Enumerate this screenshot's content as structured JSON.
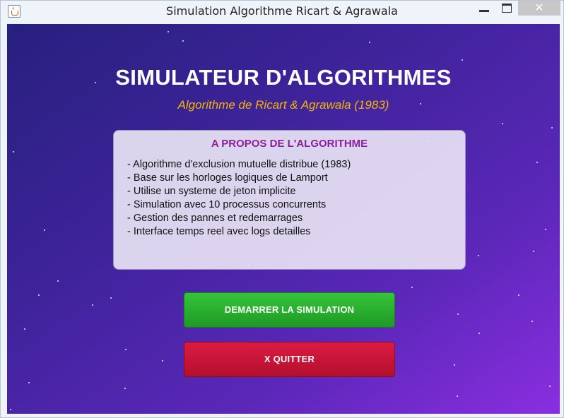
{
  "window": {
    "title": "Simulation Algorithme Ricart & Agrawala",
    "close_glyph": "✕"
  },
  "header": {
    "title": "SIMULATEUR D'ALGORITHMES",
    "subtitle": "Algorithme de Ricart & Agrawala (1983)"
  },
  "about": {
    "title": "A PROPOS DE L'ALGORITHME",
    "items": [
      "- Algorithme d'exclusion mutuelle distribue (1983)",
      "- Base sur les horloges logiques de Lamport",
      "- Utilise un systeme de jeton implicite",
      "- Simulation avec 10 processus concurrents",
      "- Gestion des pannes et redemarrages",
      "- Interface temps reel avec logs detailles"
    ]
  },
  "buttons": {
    "start_label": "DEMARRER LA SIMULATION",
    "quit_label": "X QUITTER"
  },
  "colors": {
    "background_start": "#27207e",
    "background_end": "#8a2ee0",
    "subtitle": "#f5b400",
    "about_title": "#8a1f9c",
    "start_button": "#2bb531",
    "quit_button": "#cc1538"
  },
  "icons": {
    "app": "java-cup-icon",
    "minimize": "minimize-icon",
    "maximize": "maximize-icon",
    "close": "close-icon"
  }
}
